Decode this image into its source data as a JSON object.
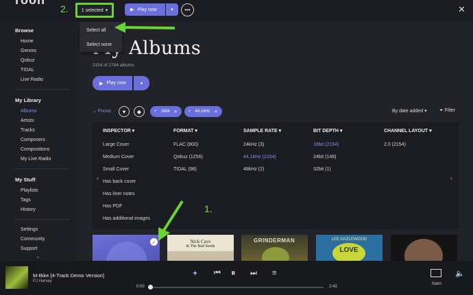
{
  "topbar": {
    "brand": "roon",
    "step2": "2.",
    "selected_label": "1 selected",
    "play_label": "Play now",
    "more_icon": "ellipsis-icon",
    "close_icon": "close-icon"
  },
  "dropdown": {
    "items": [
      "Select all",
      "Select none"
    ]
  },
  "sidebar": {
    "browse": {
      "title": "Browse",
      "items": [
        "Home",
        "Genres",
        "Qobuz",
        "TIDAL",
        "Live Radio"
      ]
    },
    "library": {
      "title": "My Library",
      "items": [
        "Albums",
        "Artists",
        "Tracks",
        "Composers",
        "Compositions",
        "My Live Radio"
      ],
      "active": "Albums"
    },
    "stuff": {
      "title": "My Stuff",
      "items": [
        "Playlists",
        "Tags",
        "History"
      ]
    },
    "footer": [
      "Settings",
      "Community",
      "Support"
    ]
  },
  "main": {
    "title": "My Albums",
    "count": "2154 of 2784 albums",
    "play_label": "Play now",
    "focus_label": "Focus",
    "chips": [
      "16bit",
      "44.1kHz"
    ],
    "sort_label": "By date added",
    "filter_label": "Filter"
  },
  "focus_panel": {
    "columns": [
      {
        "header": "INSPECTOR",
        "items": [
          "Large Cover",
          "Medium Cover",
          "Small Cover",
          "Has back cover",
          "Has liner notes",
          "Has PDF",
          "Has additional images"
        ]
      },
      {
        "header": "FORMAT",
        "items": [
          "FLAC (800)",
          "Qobuz (1256)",
          "TIDAL (98)"
        ]
      },
      {
        "header": "SAMPLE RATE",
        "items": [
          "24kHz (3)",
          "44.1kHz (2154)",
          "48kHz (2)"
        ],
        "highlight": 1
      },
      {
        "header": "BIT DEPTH",
        "items": [
          "16bit (2154)",
          "24bit (148)",
          "32bit (1)"
        ],
        "highlight": 0
      },
      {
        "header": "CHANNEL LAYOUT",
        "items": [
          "2.0 (2154)"
        ]
      }
    ]
  },
  "albums": [
    {
      "name": "Selected album",
      "texts": []
    },
    {
      "name": "Nick Cave & The Bad Seeds album",
      "texts": [
        "Nick Cave",
        "& The Bad Seeds"
      ]
    },
    {
      "name": "Grinderman album",
      "texts": [
        "GRINDERMAN"
      ]
    },
    {
      "name": "Lee Hazlewood album",
      "texts": [
        "LEE HAZLEWOOD",
        "LOVE"
      ]
    },
    {
      "name": "Portrait album",
      "texts": []
    }
  ],
  "annotation": {
    "step1": "1."
  },
  "player": {
    "track": "M-Bike [4-Track Demo Version]",
    "artist": "PJ Harvey",
    "elapsed": "0:00",
    "duration": "2:43",
    "progress": 0,
    "zone": "Naim"
  },
  "colors": {
    "accent": "#6b6fdd",
    "annotation_green": "#6bd336",
    "background": "#222329"
  }
}
